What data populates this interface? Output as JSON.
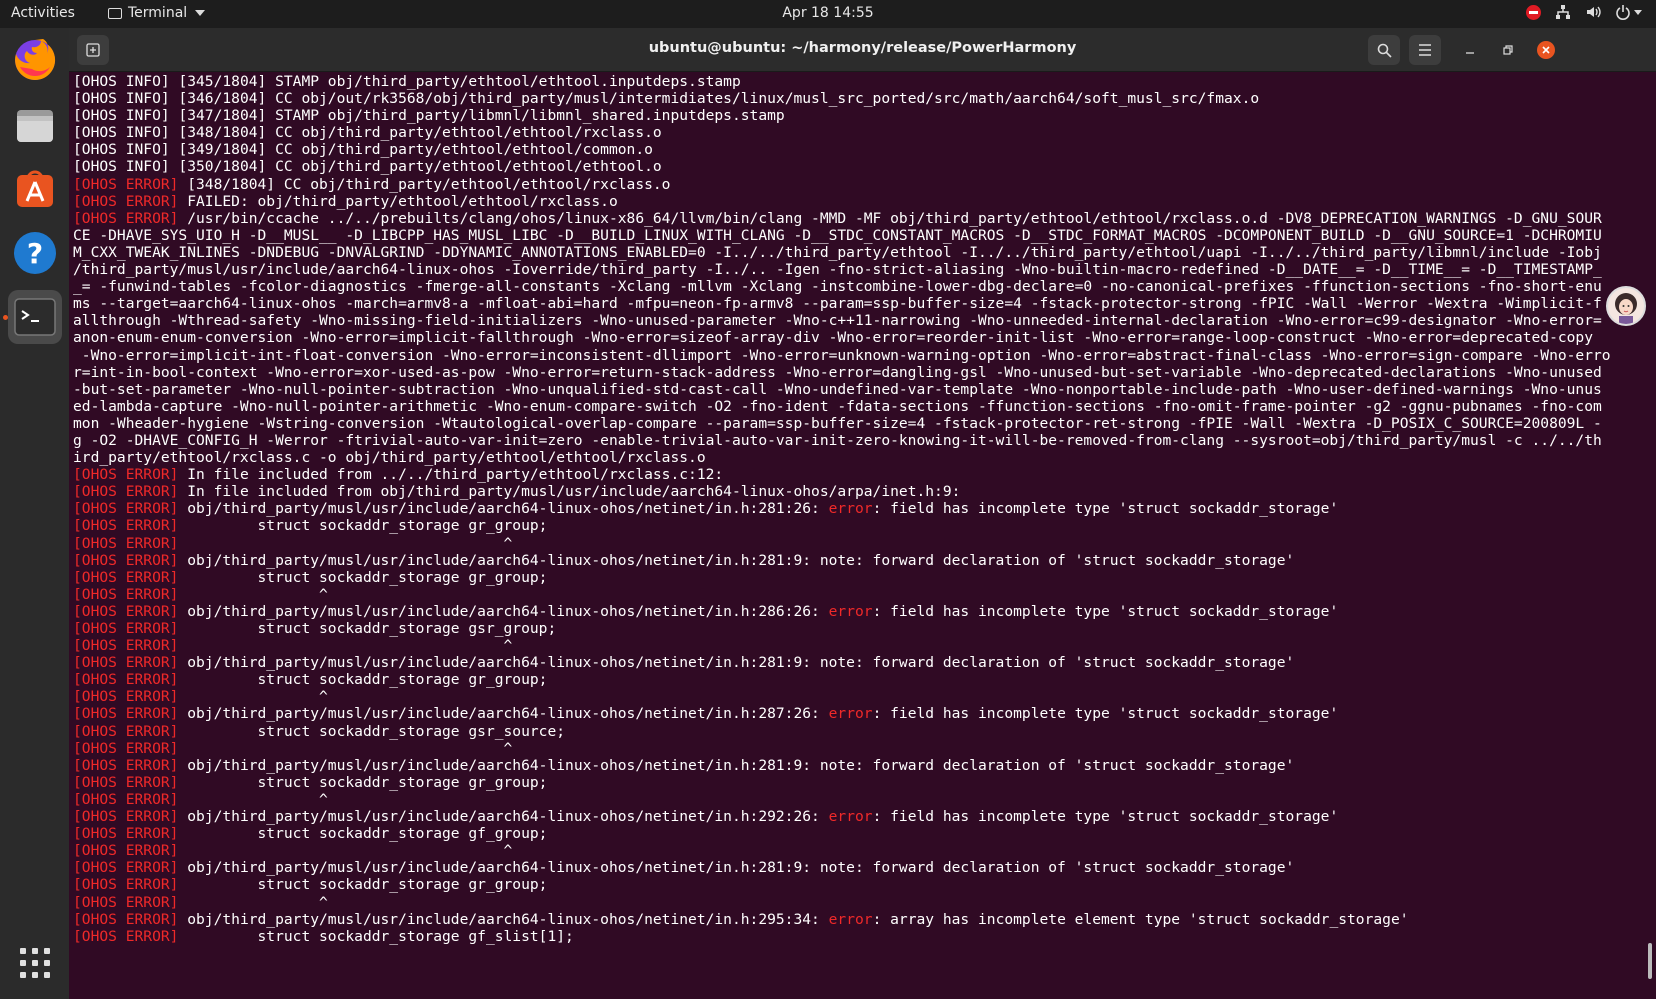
{
  "topbar": {
    "activities": "Activities",
    "app_name": "Terminal",
    "clock": "Apr 18  14:55"
  },
  "dock": {
    "items": [
      {
        "name": "Firefox",
        "icon": "firefox-icon"
      },
      {
        "name": "Files",
        "icon": "files-icon"
      },
      {
        "name": "Ubuntu Software",
        "icon": "software-icon"
      },
      {
        "name": "Help",
        "icon": "help-icon"
      },
      {
        "name": "Terminal",
        "icon": "terminal-icon"
      }
    ],
    "apps_grid": "show-apps-icon"
  },
  "window": {
    "title": "ubuntu@ubuntu: ~/harmony/release/PowerHarmony"
  },
  "terminal": {
    "lines": [
      {
        "tag": "[OHOS INFO]",
        "err": false,
        "pre": " [345/1804] STAMP obj/third_party/ethtool/ethtool.inputdeps.stamp"
      },
      {
        "tag": "[OHOS INFO]",
        "err": false,
        "pre": " [346/1804] CC obj/out/rk3568/obj/third_party/musl/intermidiates/linux/musl_src_ported/src/math/aarch64/soft_musl_src/fmax.o"
      },
      {
        "tag": "[OHOS INFO]",
        "err": false,
        "pre": " [347/1804] STAMP obj/third_party/libmnl/libmnl_shared.inputdeps.stamp"
      },
      {
        "tag": "[OHOS INFO]",
        "err": false,
        "pre": " [348/1804] CC obj/third_party/ethtool/ethtool/rxclass.o"
      },
      {
        "tag": "[OHOS INFO]",
        "err": false,
        "pre": " [349/1804] CC obj/third_party/ethtool/ethtool/common.o"
      },
      {
        "tag": "[OHOS INFO]",
        "err": false,
        "pre": " [350/1804] CC obj/third_party/ethtool/ethtool/ethtool.o"
      },
      {
        "tag": "[OHOS ERROR]",
        "err": true,
        "pre": " [348/1804] CC obj/third_party/ethtool/ethtool/rxclass.o"
      },
      {
        "tag": "[OHOS ERROR]",
        "err": true,
        "pre": " FAILED: obj/third_party/ethtool/ethtool/rxclass.o"
      },
      {
        "tag": "[OHOS ERROR]",
        "err": true,
        "pre": " /usr/bin/ccache ../../prebuilts/clang/ohos/linux-x86_64/llvm/bin/clang -MMD -MF obj/third_party/ethtool/ethtool/rxclass.o.d -DV8_DEPRECATION_WARNINGS -D_GNU_SOUR"
      },
      {
        "tag": "",
        "err": false,
        "pre": "CE -DHAVE_SYS_UIO_H -D__MUSL__ -D_LIBCPP_HAS_MUSL_LIBC -D__BUILD_LINUX_WITH_CLANG -D__STDC_CONSTANT_MACROS -D__STDC_FORMAT_MACROS -DCOMPONENT_BUILD -D__GNU_SOURCE=1 -DCHROMIU"
      },
      {
        "tag": "",
        "err": false,
        "pre": "M_CXX_TWEAK_INLINES -DNDEBUG -DNVALGRIND -DDYNAMIC_ANNOTATIONS_ENABLED=0 -I../../third_party/ethtool -I../../third_party/ethtool/uapi -I../../third_party/libmnl/include -Iobj"
      },
      {
        "tag": "",
        "err": false,
        "pre": "/third_party/musl/usr/include/aarch64-linux-ohos -Ioverride/third_party -I../.. -Igen -fno-strict-aliasing -Wno-builtin-macro-redefined -D__DATE__= -D__TIME__= -D__TIMESTAMP_"
      },
      {
        "tag": "",
        "err": false,
        "pre": "_= -funwind-tables -fcolor-diagnostics -fmerge-all-constants -Xclang -mllvm -Xclang -instcombine-lower-dbg-declare=0 -no-canonical-prefixes -ffunction-sections -fno-short-enu"
      },
      {
        "tag": "",
        "err": false,
        "pre": "ms --target=aarch64-linux-ohos -march=armv8-a -mfloat-abi=hard -mfpu=neon-fp-armv8 --param=ssp-buffer-size=4 -fstack-protector-strong -fPIC -Wall -Werror -Wextra -Wimplicit-f"
      },
      {
        "tag": "",
        "err": false,
        "pre": "allthrough -Wthread-safety -Wno-missing-field-initializers -Wno-unused-parameter -Wno-c++11-narrowing -Wno-unneeded-internal-declaration -Wno-error=c99-designator -Wno-error="
      },
      {
        "tag": "",
        "err": false,
        "pre": "anon-enum-enum-conversion -Wno-error=implicit-fallthrough -Wno-error=sizeof-array-div -Wno-error=reorder-init-list -Wno-error=range-loop-construct -Wno-error=deprecated-copy"
      },
      {
        "tag": "",
        "err": false,
        "pre": " -Wno-error=implicit-int-float-conversion -Wno-error=inconsistent-dllimport -Wno-error=unknown-warning-option -Wno-error=abstract-final-class -Wno-error=sign-compare -Wno-erro"
      },
      {
        "tag": "",
        "err": false,
        "pre": "r=int-in-bool-context -Wno-error=xor-used-as-pow -Wno-error=return-stack-address -Wno-error=dangling-gsl -Wno-unused-but-set-variable -Wno-deprecated-declarations -Wno-unused"
      },
      {
        "tag": "",
        "err": false,
        "pre": "-but-set-parameter -Wno-null-pointer-subtraction -Wno-unqualified-std-cast-call -Wno-undefined-var-template -Wno-nonportable-include-path -Wno-user-defined-warnings -Wno-unus"
      },
      {
        "tag": "",
        "err": false,
        "pre": "ed-lambda-capture -Wno-null-pointer-arithmetic -Wno-enum-compare-switch -O2 -fno-ident -fdata-sections -ffunction-sections -fno-omit-frame-pointer -g2 -ggnu-pubnames -fno-com"
      },
      {
        "tag": "",
        "err": false,
        "pre": "mon -Wheader-hygiene -Wstring-conversion -Wtautological-overlap-compare --param=ssp-buffer-size=4 -fstack-protector-ret-strong -fPIE -Wall -Wextra -D_POSIX_C_SOURCE=200809L -"
      },
      {
        "tag": "",
        "err": false,
        "pre": "g -O2 -DHAVE_CONFIG_H -Werror -ftrivial-auto-var-init=zero -enable-trivial-auto-var-init-zero-knowing-it-will-be-removed-from-clang --sysroot=obj/third_party/musl -c ../../th"
      },
      {
        "tag": "",
        "err": false,
        "pre": "ird_party/ethtool/rxclass.c -o obj/third_party/ethtool/ethtool/rxclass.o"
      },
      {
        "tag": "[OHOS ERROR]",
        "err": true,
        "pre": " In file included from ../../third_party/ethtool/rxclass.c:12:"
      },
      {
        "tag": "[OHOS ERROR]",
        "err": true,
        "pre": " In file included from obj/third_party/musl/usr/include/aarch64-linux-ohos/arpa/inet.h:9:"
      },
      {
        "tag": "[OHOS ERROR]",
        "err": true,
        "pre": " obj/third_party/musl/usr/include/aarch64-linux-ohos/netinet/in.h:281:26: ",
        "kw": "error",
        "post": ": field has incomplete type 'struct sockaddr_storage'"
      },
      {
        "tag": "[OHOS ERROR]",
        "err": true,
        "pre": "         struct sockaddr_storage gr_group;"
      },
      {
        "tag": "[OHOS ERROR]",
        "err": true,
        "pre": "                                     ^"
      },
      {
        "tag": "[OHOS ERROR]",
        "err": true,
        "pre": " obj/third_party/musl/usr/include/aarch64-linux-ohos/netinet/in.h:281:9: note: forward declaration of 'struct sockaddr_storage'"
      },
      {
        "tag": "[OHOS ERROR]",
        "err": true,
        "pre": "         struct sockaddr_storage gr_group;"
      },
      {
        "tag": "[OHOS ERROR]",
        "err": true,
        "pre": "                ^"
      },
      {
        "tag": "[OHOS ERROR]",
        "err": true,
        "pre": " obj/third_party/musl/usr/include/aarch64-linux-ohos/netinet/in.h:286:26: ",
        "kw": "error",
        "post": ": field has incomplete type 'struct sockaddr_storage'"
      },
      {
        "tag": "[OHOS ERROR]",
        "err": true,
        "pre": "         struct sockaddr_storage gsr_group;"
      },
      {
        "tag": "[OHOS ERROR]",
        "err": true,
        "pre": "                                     ^"
      },
      {
        "tag": "[OHOS ERROR]",
        "err": true,
        "pre": " obj/third_party/musl/usr/include/aarch64-linux-ohos/netinet/in.h:281:9: note: forward declaration of 'struct sockaddr_storage'"
      },
      {
        "tag": "[OHOS ERROR]",
        "err": true,
        "pre": "         struct sockaddr_storage gr_group;"
      },
      {
        "tag": "[OHOS ERROR]",
        "err": true,
        "pre": "                ^"
      },
      {
        "tag": "[OHOS ERROR]",
        "err": true,
        "pre": " obj/third_party/musl/usr/include/aarch64-linux-ohos/netinet/in.h:287:26: ",
        "kw": "error",
        "post": ": field has incomplete type 'struct sockaddr_storage'"
      },
      {
        "tag": "[OHOS ERROR]",
        "err": true,
        "pre": "         struct sockaddr_storage gsr_source;"
      },
      {
        "tag": "[OHOS ERROR]",
        "err": true,
        "pre": "                                     ^"
      },
      {
        "tag": "[OHOS ERROR]",
        "err": true,
        "pre": " obj/third_party/musl/usr/include/aarch64-linux-ohos/netinet/in.h:281:9: note: forward declaration of 'struct sockaddr_storage'"
      },
      {
        "tag": "[OHOS ERROR]",
        "err": true,
        "pre": "         struct sockaddr_storage gr_group;"
      },
      {
        "tag": "[OHOS ERROR]",
        "err": true,
        "pre": "                ^"
      },
      {
        "tag": "[OHOS ERROR]",
        "err": true,
        "pre": " obj/third_party/musl/usr/include/aarch64-linux-ohos/netinet/in.h:292:26: ",
        "kw": "error",
        "post": ": field has incomplete type 'struct sockaddr_storage'"
      },
      {
        "tag": "[OHOS ERROR]",
        "err": true,
        "pre": "         struct sockaddr_storage gf_group;"
      },
      {
        "tag": "[OHOS ERROR]",
        "err": true,
        "pre": "                                     ^"
      },
      {
        "tag": "[OHOS ERROR]",
        "err": true,
        "pre": " obj/third_party/musl/usr/include/aarch64-linux-ohos/netinet/in.h:281:9: note: forward declaration of 'struct sockaddr_storage'"
      },
      {
        "tag": "[OHOS ERROR]",
        "err": true,
        "pre": "         struct sockaddr_storage gr_group;"
      },
      {
        "tag": "[OHOS ERROR]",
        "err": true,
        "pre": "                ^"
      },
      {
        "tag": "[OHOS ERROR]",
        "err": true,
        "pre": " obj/third_party/musl/usr/include/aarch64-linux-ohos/netinet/in.h:295:34: ",
        "kw": "error",
        "post": ": array has incomplete element type 'struct sockaddr_storage'"
      },
      {
        "tag": "[OHOS ERROR]",
        "err": true,
        "pre": "         struct sockaddr_storage gf_slist[1];"
      }
    ]
  },
  "colors": {
    "terminal_bg": "#300a24",
    "error_red": "#ef2929",
    "accent": "#e95420"
  }
}
